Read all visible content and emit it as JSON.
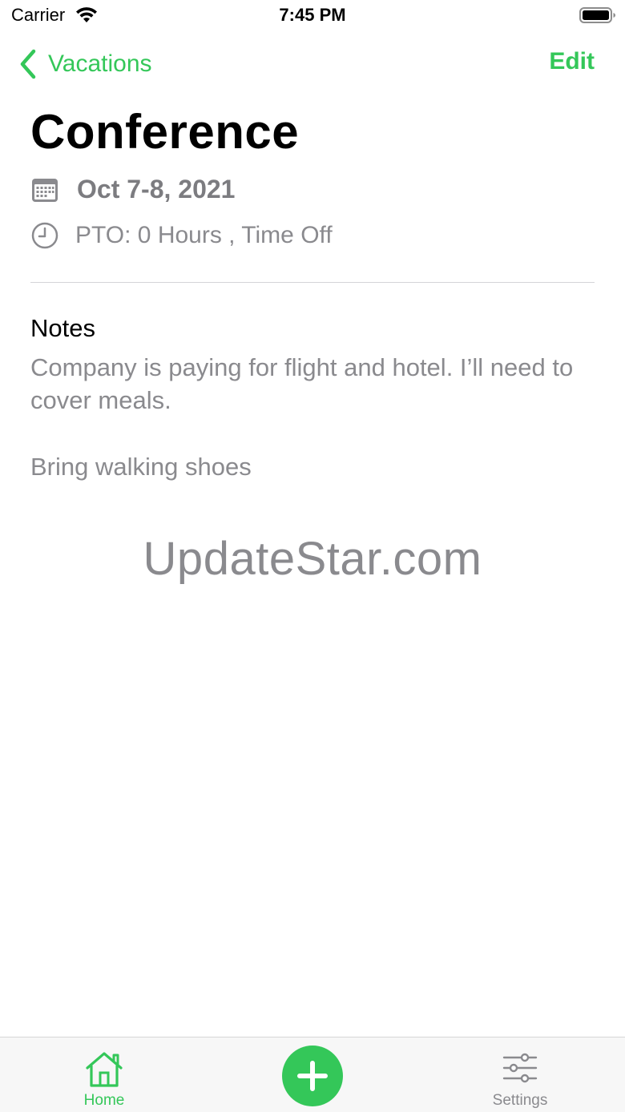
{
  "status_bar": {
    "carrier": "Carrier",
    "time": "7:45 PM",
    "icons": [
      "wifi-icon",
      "battery-icon"
    ]
  },
  "nav": {
    "back_label": "Vacations",
    "edit_label": "Edit",
    "accent_color": "#34c759"
  },
  "event": {
    "title": "Conference",
    "date": "Oct 7-8, 2021",
    "pto": "PTO:  0 Hours , Time Off"
  },
  "notes": {
    "heading": "Notes",
    "paragraphs": [
      "Company is paying for flight and hotel. I’ll need to cover meals.",
      "Bring walking shoes"
    ]
  },
  "watermark": "UpdateStar.com",
  "tab_bar": {
    "home_label": "Home",
    "settings_label": "Settings",
    "active_tab": "Home",
    "icons": [
      "home-icon",
      "plus-icon",
      "sliders-icon"
    ]
  }
}
